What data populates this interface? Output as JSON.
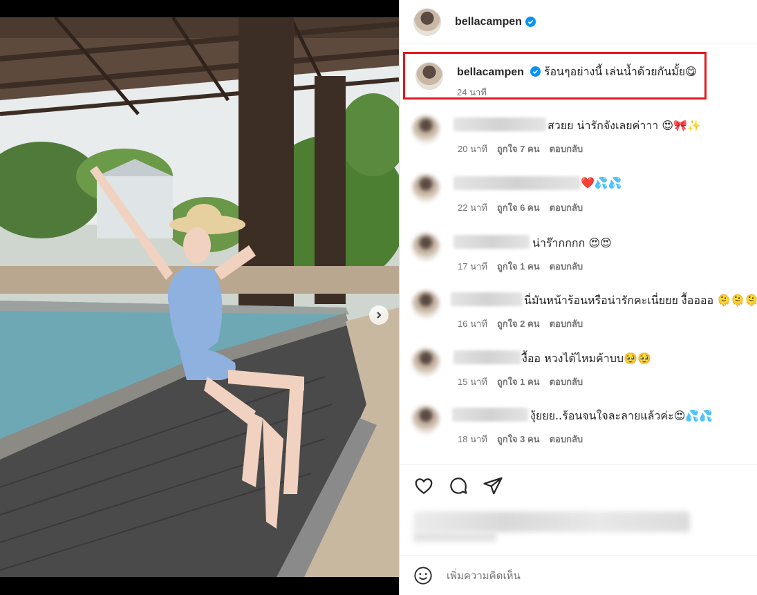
{
  "post": {
    "username": "bellacampen",
    "verified": true,
    "carousel": {
      "count": 2,
      "active": 1
    }
  },
  "caption": {
    "username": "bellacampen",
    "text": "ร้อนๆอย่างนี้ เล่นน้ำด้วยกันมั้ย😋",
    "time": "24 นาที"
  },
  "comments": [
    {
      "text": "สวยย น่ารักจังเลยค่าาา 😍🎀✨",
      "time": "20 นาที",
      "likes": "ถูกใจ 7 คน",
      "reply": "ตอบกลับ"
    },
    {
      "text": "❤️💦💦",
      "time": "22 นาที",
      "likes": "ถูกใจ 6 คน",
      "reply": "ตอบกลับ"
    },
    {
      "text": "น่าร๊ากกกก 😍😍",
      "time": "17 นาที",
      "likes": "ถูกใจ 1 คน",
      "reply": "ตอบกลับ"
    },
    {
      "text": "นี่มันหน้าร้อนหรือน่ารักคะเนี่ยยย งื้ออออ 🫠🫠🫠",
      "time": "16 นาที",
      "likes": "ถูกใจ 2 คน",
      "reply": "ตอบกลับ"
    },
    {
      "text": "งื้ออ หวงได้ไหมค้าบบ🥹🥹",
      "time": "15 นาที",
      "likes": "ถูกใจ 1 คน",
      "reply": "ตอบกลับ"
    },
    {
      "text": "งุ้ยยย..ร้อนจนใจละลายแล้วค่ะ😍💦💦",
      "time": "18 นาที",
      "likes": "ถูกใจ 3 คน",
      "reply": "ตอบกลับ"
    }
  ],
  "add_comment": {
    "placeholder": "เพิ่มความคิดเห็น"
  },
  "icons": {
    "like": "heart-icon",
    "comment": "comment-bubble-icon",
    "share": "paper-plane-icon",
    "emoji": "smiley-icon",
    "next": "chevron-right-icon"
  },
  "colors": {
    "verified": "#0095f6",
    "highlight": "#e0191f"
  }
}
